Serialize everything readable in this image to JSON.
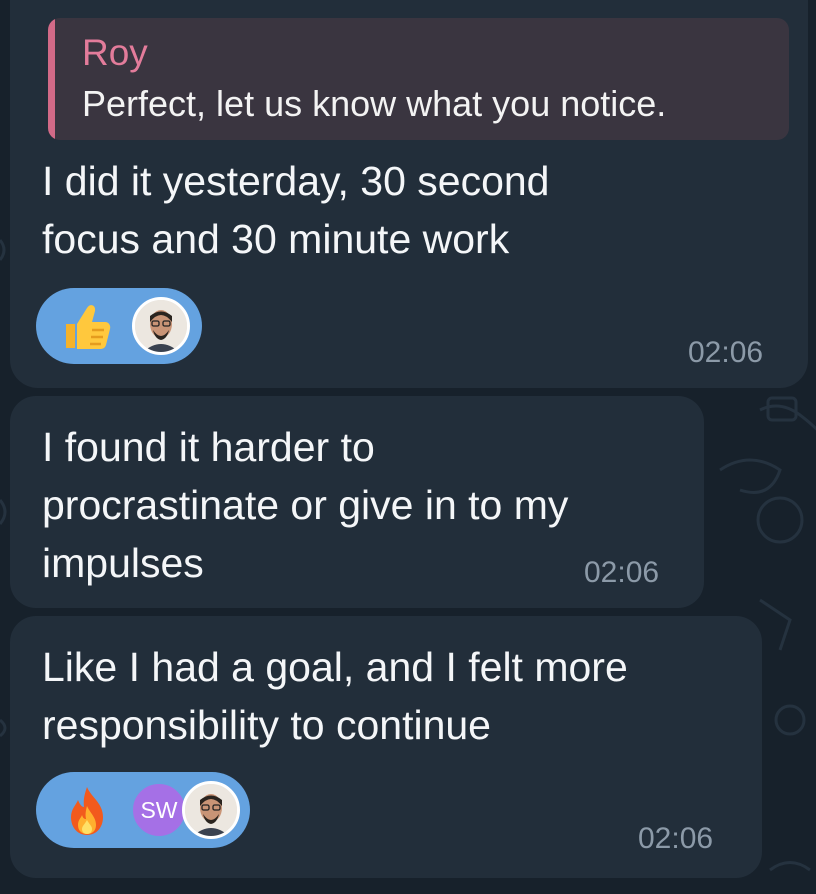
{
  "messages": [
    {
      "reply": {
        "author": "Roy",
        "text": "Perfect, let us know what you notice."
      },
      "text": "I did it yesterday, 30 second\nfocus and 30 minute work",
      "time": "02:06",
      "reactions": {
        "emoji": "thumbs-up-icon",
        "reactors": [
          "bearded-man-avatar"
        ]
      }
    },
    {
      "text": "I found it harder to\nprocrastinate or give in to my\nimpulses",
      "time": "02:06"
    },
    {
      "text": "Like I had a goal, and I felt more\nresponsibility to continue",
      "time": "02:06",
      "reactions": {
        "emoji": "fire-icon",
        "reactors": [
          "SW",
          "bearded-man-avatar"
        ]
      }
    }
  ],
  "colors": {
    "background": "#17212b",
    "bubble": "#222e3a",
    "reply_bar": "#d26a87",
    "reply_author": "#e37c9b",
    "reaction_pill": "#64a2e0",
    "sw_avatar": "#a570e6",
    "timestamp": "#8c9aa8"
  }
}
